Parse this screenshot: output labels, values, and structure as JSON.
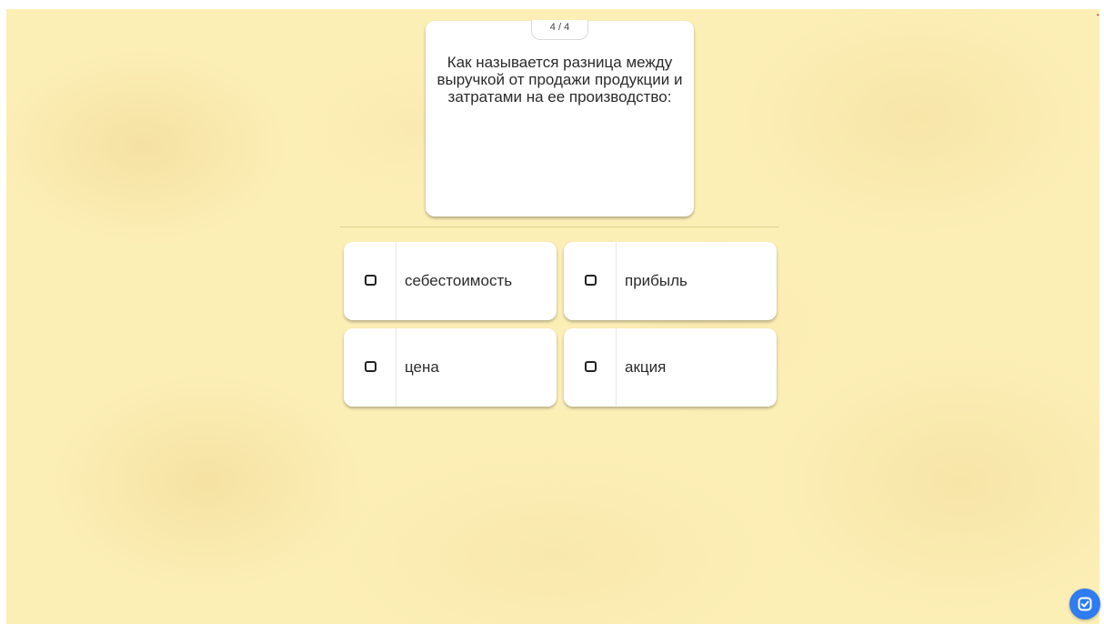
{
  "quiz": {
    "counter": "4 / 4",
    "question": "Как называется разница между выручкой от продажи продукции и затратами на ее производство:",
    "options": [
      {
        "label": "себестоимость",
        "checked": false
      },
      {
        "label": "прибыль",
        "checked": false
      },
      {
        "label": "цена",
        "checked": false
      },
      {
        "label": "акция",
        "checked": false
      }
    ]
  },
  "icons": {
    "submit": "check-square-icon",
    "checkbox": "checkbox-icon"
  },
  "colors": {
    "background": "#fcefb6",
    "card": "#ffffff",
    "accent": "#2f7bf0",
    "text": "#2b2b2b"
  }
}
